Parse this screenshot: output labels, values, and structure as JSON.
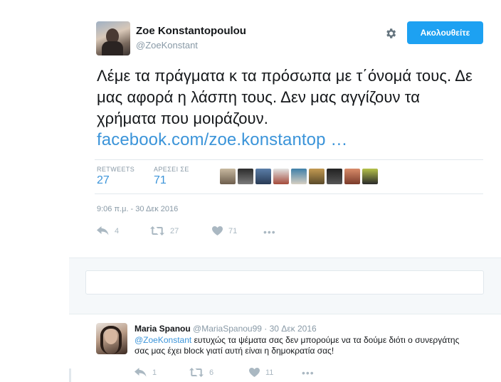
{
  "tweet": {
    "author_name": "Zoe Konstantopoulou",
    "author_handle": "@ZoeKonstant",
    "follow_label": "Ακολουθείτε",
    "text": "Λέμε τα πράγματα κ τα πρόσωπα με τ΄όνομά τους. Δε μας αφορά η λάσπη τους. Δεν μας αγγίζουν τα χρήματα που μοιράζουν.",
    "link_text": "facebook.com/zoe.konstantop …",
    "retweets_label": "RETWEETS",
    "retweets_count": "27",
    "likes_label": "ΑΡΕΣΕΙ ΣΕ",
    "likes_count": "71",
    "timestamp": "9:06 π.μ. - 30 Δεκ 2016",
    "actions": {
      "reply": "4",
      "retweet": "27",
      "like": "71"
    }
  },
  "reply": {
    "author_name": "Maria Spanou",
    "author_handle": "@MariaSpanou99",
    "date": "· 30 Δεκ 2016",
    "mention": "@ZoeKonstant",
    "text": "ευτυχώς τα ψέματα σας δεν μπορούμε να τα δούμε διότι ο συνεργάτης σας μας έχει block γιατί αυτή είναι η δημοκρατία σας!",
    "actions": {
      "reply": "1",
      "retweet": "6",
      "like": "11"
    }
  },
  "colors": {
    "accent": "#1da1f2",
    "link": "#3b94d9",
    "muted": "#8899a6",
    "reply_bg": "#f5f8fa"
  }
}
